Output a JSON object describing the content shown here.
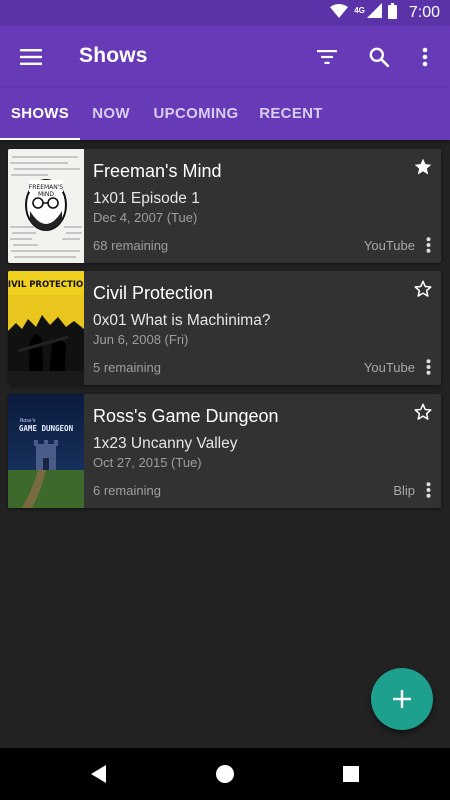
{
  "status_bar": {
    "network": "4G",
    "time": "7:00"
  },
  "app_bar": {
    "title": "Shows",
    "icons": [
      "menu-icon",
      "filter-icon",
      "search-icon",
      "overflow-menu-icon"
    ]
  },
  "tabs": [
    {
      "label": "SHOWS",
      "active": true
    },
    {
      "label": "NOW",
      "active": false
    },
    {
      "label": "UPCOMING",
      "active": false
    },
    {
      "label": "RECENT",
      "active": false
    }
  ],
  "shows": [
    {
      "title": "Freeman's Mind",
      "episode": "1x01 Episode 1",
      "date": "Dec 4, 2007 (Tue)",
      "remaining": "68 remaining",
      "network": "YouTube",
      "favorite": true,
      "poster_text": "FREEMAN'S MIND"
    },
    {
      "title": "Civil Protection",
      "episode": "0x01 What is Machinima?",
      "date": "Jun 6, 2008 (Fri)",
      "remaining": "5 remaining",
      "network": "YouTube",
      "favorite": false,
      "poster_text": "CIVIL PROTECTION"
    },
    {
      "title": "Ross's Game Dungeon",
      "episode": "1x23 Uncanny Valley",
      "date": "Oct 27, 2015 (Tue)",
      "remaining": "6 remaining",
      "network": "Blip",
      "favorite": false,
      "poster_text": "GAME DUNGEON"
    }
  ],
  "colors": {
    "primary": "#673ab7",
    "status_bar": "#5b33a8",
    "accent": "#1da08e",
    "background": "#222222",
    "card": "#323232"
  }
}
